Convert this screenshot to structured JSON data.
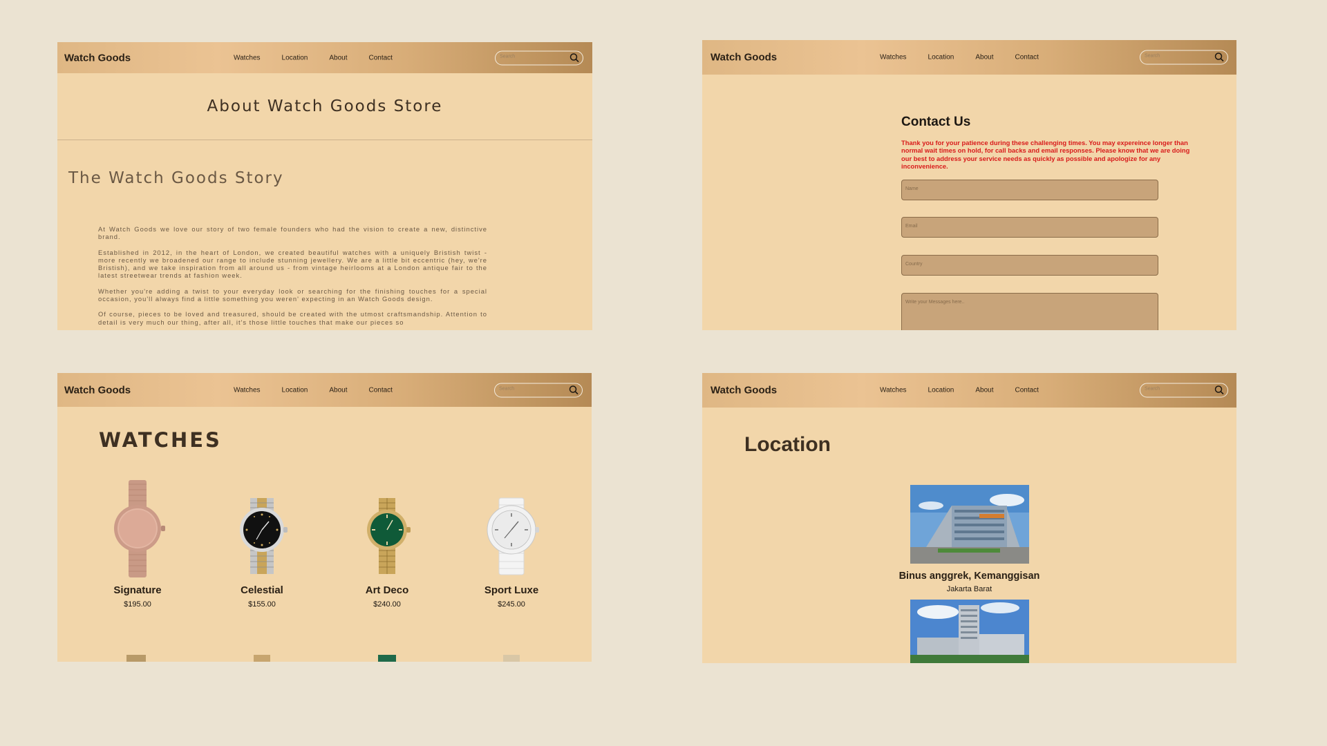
{
  "nav": {
    "brand": "Watch Goods",
    "links": [
      "Watches",
      "Location",
      "About",
      "Contact"
    ],
    "search_placeholder": "Search"
  },
  "about": {
    "title": "About Watch Goods Store",
    "story_title": "The Watch Goods Story",
    "paragraphs": [
      "At Watch Goods we love our story of two female founders who had the vision to create a new, distinctive brand.",
      "Established in 2012, in the heart of London, we created beautiful watches with a uniquely Bristish twist - more recently we broadened our range to include stunning jewellery. We are a little bit eccentric (hey, we're Bristish), and we take inspiration from all around us - from vintage heirlooms at a London antique fair to the latest streetwear trends at fashion week.",
      "Whether you're adding a twist to your everyday look or searching for the finishing touches for a special occasion, you'll always find a little something you weren' expecting in an Watch Goods design.",
      "Of course, pieces to be loved and treasured, should be created with the utmost craftsmandship. Attention to detail is very much our thing, after all, it's those little touches that make our pieces so"
    ]
  },
  "contact": {
    "title": "Contact Us",
    "notice": "Thank you for your patience during these challenging times. You may expereince longer than normal wait times on hold, for call backs and email responses. Please know that we are doing our best to address your service needs as quickly as possible and apologize for any inconvenience.",
    "fields": {
      "name_placeholder": "Name",
      "email_placeholder": "Email",
      "country_placeholder": "Country",
      "message_placeholder": "Write your Messages here.."
    }
  },
  "watches": {
    "title": "WATCHES",
    "items": [
      {
        "name": "Signature",
        "price": "$195.00"
      },
      {
        "name": "Celestial",
        "price": "$155.00"
      },
      {
        "name": "Art Deco",
        "price": "$240.00"
      },
      {
        "name": "Sport Luxe",
        "price": "$245.00"
      }
    ]
  },
  "location": {
    "title": "Location",
    "places": [
      {
        "name": "Binus anggrek, Kemanggisan",
        "area": "Jakarta Barat"
      }
    ]
  },
  "colors": {
    "background": "#ebe3d2",
    "panel": "#f2d6aa",
    "navbar_light": "#ebc393",
    "navbar_dark": "#b58a55",
    "notice_red": "#d81b1b",
    "field_fill": "#c8a47a"
  },
  "icons": {
    "search": "magnifier-icon"
  }
}
